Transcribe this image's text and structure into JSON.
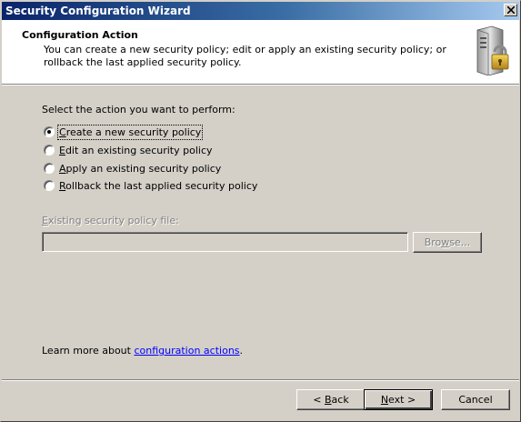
{
  "window": {
    "title": "Security Configuration Wizard"
  },
  "header": {
    "title": "Configuration Action",
    "description": "You can create a new security policy; edit or apply an existing security policy; or rollback the last applied security policy."
  },
  "main": {
    "prompt": "Select the action you want to perform:",
    "options": [
      {
        "mnemonic": "C",
        "rest": "reate a new security policy",
        "checked": true
      },
      {
        "mnemonic": "E",
        "rest": "dit an existing security policy",
        "checked": false
      },
      {
        "mnemonic": "A",
        "rest": "pply an existing security policy",
        "checked": false
      },
      {
        "mnemonic": "R",
        "rest": "ollback the last applied security policy",
        "checked": false
      }
    ],
    "file_label_mnemonic": "E",
    "file_label_rest": "xisting security policy file:",
    "file_value": "",
    "browse_mnemonic": "w",
    "browse_pre": "Bro",
    "browse_post": "se...",
    "learn_text": "Learn more about ",
    "learn_link": "configuration actions",
    "learn_end": "."
  },
  "footer": {
    "back_pre": "< ",
    "back_mnemonic": "B",
    "back_post": "ack",
    "next_mnemonic": "N",
    "next_post": "ext >",
    "cancel": "Cancel"
  },
  "colors": {
    "title_start": "#0a246a",
    "title_end": "#a6caf0",
    "face": "#d4d0c8",
    "link": "#0000ff"
  },
  "icons": {
    "close": "close-icon",
    "header": "server-lock-icon"
  }
}
